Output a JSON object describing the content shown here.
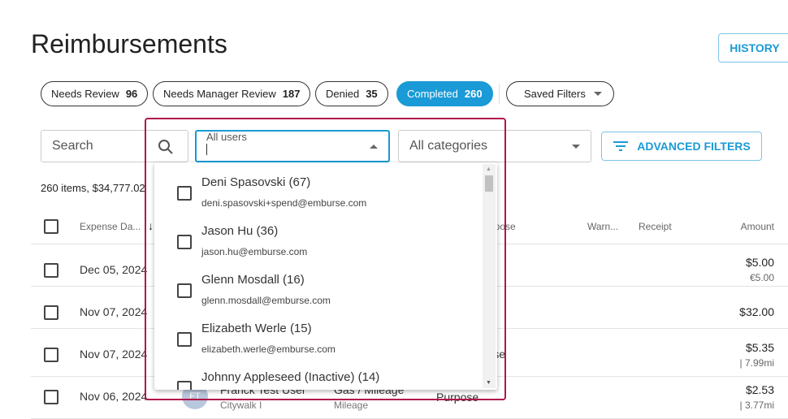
{
  "page": {
    "title": "Reimbursements",
    "history_label": "HISTORY"
  },
  "chips": [
    {
      "label": "Needs Review",
      "count": "96"
    },
    {
      "label": "Needs Manager Review",
      "count": "187"
    },
    {
      "label": "Denied",
      "count": "35"
    },
    {
      "label": "Completed",
      "count": "260",
      "active": true
    },
    {
      "label": "Saved Filters"
    }
  ],
  "filters": {
    "search_placeholder": "Search",
    "users_label": "All users",
    "categories_value": "All categories",
    "advanced_label": "ADVANCED FILTERS"
  },
  "summary": "260 items, $34,777.02",
  "table": {
    "headers": {
      "date": "Expense Da...",
      "purpose": "Purpose",
      "warn": "Warn...",
      "receipt": "Receipt",
      "amount": "Amount"
    },
    "rows": [
      {
        "date": "Dec 05, 2024",
        "amount": "$5.00",
        "sub": "€5.00"
      },
      {
        "date": "Nov 07, 2024",
        "amount": "$32.00"
      },
      {
        "date": "Nov 07, 2024",
        "purpose": "Purpose",
        "amount": "$5.35",
        "sub": "7.99mi"
      },
      {
        "date": "Nov 06, 2024",
        "avatar": "FT",
        "user": "Franck Test User",
        "user_sub": "Citywalk I",
        "category": "Gas / Mileage",
        "category_sub": "Mileage",
        "purpose": "Purpose",
        "amount": "$2.53",
        "sub": "3.77mi"
      }
    ]
  },
  "users_dropdown": [
    {
      "name": "Deni Spasovski (67)",
      "email": "deni.spasovski+spend@emburse.com"
    },
    {
      "name": "Jason Hu (36)",
      "email": "jason.hu@emburse.com"
    },
    {
      "name": "Glenn Mosdall (16)",
      "email": "glenn.mosdall@emburse.com"
    },
    {
      "name": "Elizabeth Werle (15)",
      "email": "elizabeth.werle@emburse.com"
    },
    {
      "name": "Johnny Appleseed (Inactive) (14)",
      "email": ""
    }
  ],
  "colors": {
    "accent": "#1a9ad6",
    "highlight": "#b0164a"
  }
}
